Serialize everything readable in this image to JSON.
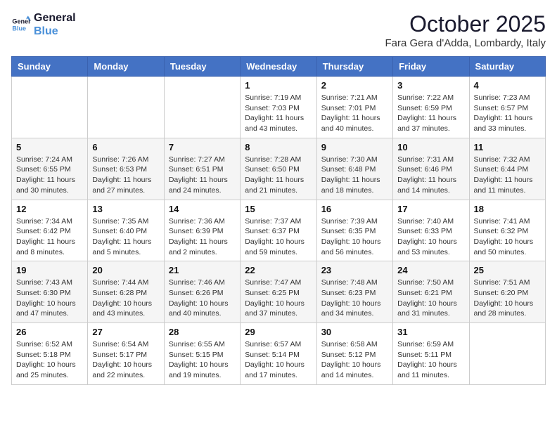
{
  "logo": {
    "line1": "General",
    "line2": "Blue"
  },
  "title": "October 2025",
  "location": "Fara Gera d'Adda, Lombardy, Italy",
  "days_of_week": [
    "Sunday",
    "Monday",
    "Tuesday",
    "Wednesday",
    "Thursday",
    "Friday",
    "Saturday"
  ],
  "weeks": [
    [
      {
        "day": "",
        "sunrise": "",
        "sunset": "",
        "daylight": ""
      },
      {
        "day": "",
        "sunrise": "",
        "sunset": "",
        "daylight": ""
      },
      {
        "day": "",
        "sunrise": "",
        "sunset": "",
        "daylight": ""
      },
      {
        "day": "1",
        "sunrise": "Sunrise: 7:19 AM",
        "sunset": "Sunset: 7:03 PM",
        "daylight": "Daylight: 11 hours and 43 minutes."
      },
      {
        "day": "2",
        "sunrise": "Sunrise: 7:21 AM",
        "sunset": "Sunset: 7:01 PM",
        "daylight": "Daylight: 11 hours and 40 minutes."
      },
      {
        "day": "3",
        "sunrise": "Sunrise: 7:22 AM",
        "sunset": "Sunset: 6:59 PM",
        "daylight": "Daylight: 11 hours and 37 minutes."
      },
      {
        "day": "4",
        "sunrise": "Sunrise: 7:23 AM",
        "sunset": "Sunset: 6:57 PM",
        "daylight": "Daylight: 11 hours and 33 minutes."
      }
    ],
    [
      {
        "day": "5",
        "sunrise": "Sunrise: 7:24 AM",
        "sunset": "Sunset: 6:55 PM",
        "daylight": "Daylight: 11 hours and 30 minutes."
      },
      {
        "day": "6",
        "sunrise": "Sunrise: 7:26 AM",
        "sunset": "Sunset: 6:53 PM",
        "daylight": "Daylight: 11 hours and 27 minutes."
      },
      {
        "day": "7",
        "sunrise": "Sunrise: 7:27 AM",
        "sunset": "Sunset: 6:51 PM",
        "daylight": "Daylight: 11 hours and 24 minutes."
      },
      {
        "day": "8",
        "sunrise": "Sunrise: 7:28 AM",
        "sunset": "Sunset: 6:50 PM",
        "daylight": "Daylight: 11 hours and 21 minutes."
      },
      {
        "day": "9",
        "sunrise": "Sunrise: 7:30 AM",
        "sunset": "Sunset: 6:48 PM",
        "daylight": "Daylight: 11 hours and 18 minutes."
      },
      {
        "day": "10",
        "sunrise": "Sunrise: 7:31 AM",
        "sunset": "Sunset: 6:46 PM",
        "daylight": "Daylight: 11 hours and 14 minutes."
      },
      {
        "day": "11",
        "sunrise": "Sunrise: 7:32 AM",
        "sunset": "Sunset: 6:44 PM",
        "daylight": "Daylight: 11 hours and 11 minutes."
      }
    ],
    [
      {
        "day": "12",
        "sunrise": "Sunrise: 7:34 AM",
        "sunset": "Sunset: 6:42 PM",
        "daylight": "Daylight: 11 hours and 8 minutes."
      },
      {
        "day": "13",
        "sunrise": "Sunrise: 7:35 AM",
        "sunset": "Sunset: 6:40 PM",
        "daylight": "Daylight: 11 hours and 5 minutes."
      },
      {
        "day": "14",
        "sunrise": "Sunrise: 7:36 AM",
        "sunset": "Sunset: 6:39 PM",
        "daylight": "Daylight: 11 hours and 2 minutes."
      },
      {
        "day": "15",
        "sunrise": "Sunrise: 7:37 AM",
        "sunset": "Sunset: 6:37 PM",
        "daylight": "Daylight: 10 hours and 59 minutes."
      },
      {
        "day": "16",
        "sunrise": "Sunrise: 7:39 AM",
        "sunset": "Sunset: 6:35 PM",
        "daylight": "Daylight: 10 hours and 56 minutes."
      },
      {
        "day": "17",
        "sunrise": "Sunrise: 7:40 AM",
        "sunset": "Sunset: 6:33 PM",
        "daylight": "Daylight: 10 hours and 53 minutes."
      },
      {
        "day": "18",
        "sunrise": "Sunrise: 7:41 AM",
        "sunset": "Sunset: 6:32 PM",
        "daylight": "Daylight: 10 hours and 50 minutes."
      }
    ],
    [
      {
        "day": "19",
        "sunrise": "Sunrise: 7:43 AM",
        "sunset": "Sunset: 6:30 PM",
        "daylight": "Daylight: 10 hours and 47 minutes."
      },
      {
        "day": "20",
        "sunrise": "Sunrise: 7:44 AM",
        "sunset": "Sunset: 6:28 PM",
        "daylight": "Daylight: 10 hours and 43 minutes."
      },
      {
        "day": "21",
        "sunrise": "Sunrise: 7:46 AM",
        "sunset": "Sunset: 6:26 PM",
        "daylight": "Daylight: 10 hours and 40 minutes."
      },
      {
        "day": "22",
        "sunrise": "Sunrise: 7:47 AM",
        "sunset": "Sunset: 6:25 PM",
        "daylight": "Daylight: 10 hours and 37 minutes."
      },
      {
        "day": "23",
        "sunrise": "Sunrise: 7:48 AM",
        "sunset": "Sunset: 6:23 PM",
        "daylight": "Daylight: 10 hours and 34 minutes."
      },
      {
        "day": "24",
        "sunrise": "Sunrise: 7:50 AM",
        "sunset": "Sunset: 6:21 PM",
        "daylight": "Daylight: 10 hours and 31 minutes."
      },
      {
        "day": "25",
        "sunrise": "Sunrise: 7:51 AM",
        "sunset": "Sunset: 6:20 PM",
        "daylight": "Daylight: 10 hours and 28 minutes."
      }
    ],
    [
      {
        "day": "26",
        "sunrise": "Sunrise: 6:52 AM",
        "sunset": "Sunset: 5:18 PM",
        "daylight": "Daylight: 10 hours and 25 minutes."
      },
      {
        "day": "27",
        "sunrise": "Sunrise: 6:54 AM",
        "sunset": "Sunset: 5:17 PM",
        "daylight": "Daylight: 10 hours and 22 minutes."
      },
      {
        "day": "28",
        "sunrise": "Sunrise: 6:55 AM",
        "sunset": "Sunset: 5:15 PM",
        "daylight": "Daylight: 10 hours and 19 minutes."
      },
      {
        "day": "29",
        "sunrise": "Sunrise: 6:57 AM",
        "sunset": "Sunset: 5:14 PM",
        "daylight": "Daylight: 10 hours and 17 minutes."
      },
      {
        "day": "30",
        "sunrise": "Sunrise: 6:58 AM",
        "sunset": "Sunset: 5:12 PM",
        "daylight": "Daylight: 10 hours and 14 minutes."
      },
      {
        "day": "31",
        "sunrise": "Sunrise: 6:59 AM",
        "sunset": "Sunset: 5:11 PM",
        "daylight": "Daylight: 10 hours and 11 minutes."
      },
      {
        "day": "",
        "sunrise": "",
        "sunset": "",
        "daylight": ""
      }
    ]
  ]
}
